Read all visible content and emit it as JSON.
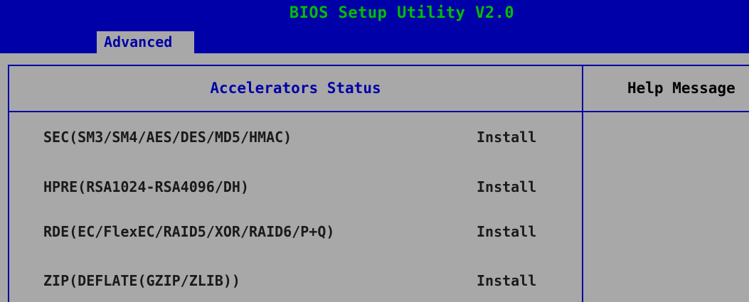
{
  "title": "BIOS Setup Utility V2.0",
  "tabs": [
    {
      "label": "Advanced",
      "active": true
    }
  ],
  "section": {
    "header": "Accelerators Status"
  },
  "help": {
    "header": "Help Message"
  },
  "items": [
    {
      "label": "SEC(SM3/SM4/AES/DES/MD5/HMAC)",
      "value": "Install"
    },
    {
      "label": "HPRE(RSA1024-RSA4096/DH)",
      "value": "Install"
    },
    {
      "label": "RDE(EC/FlexEC/RAID5/XOR/RAID6/P+Q)",
      "value": "Install"
    },
    {
      "label": "ZIP(DEFLATE(GZIP/ZLIB))",
      "value": "Install"
    }
  ],
  "colors": {
    "title_bar": "#0000a8",
    "title_text": "#00c000",
    "panel": "#a8a8a8",
    "accent_text": "#0000a8"
  }
}
